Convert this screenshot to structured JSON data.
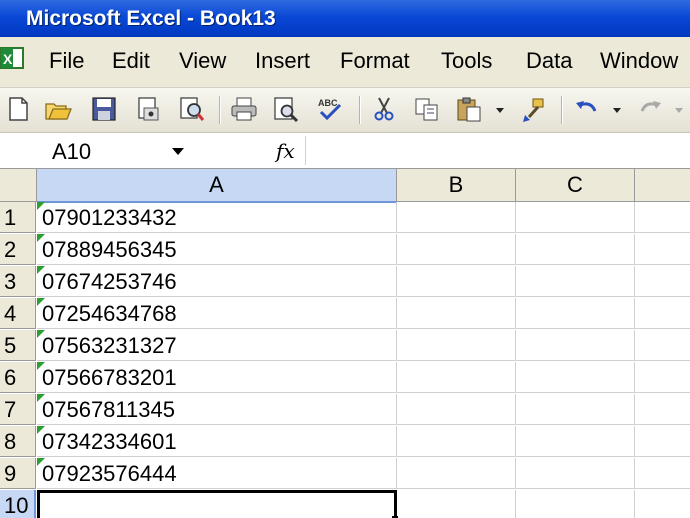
{
  "window": {
    "title": "Microsoft Excel - Book13"
  },
  "menu": {
    "items": [
      "File",
      "Edit",
      "View",
      "Insert",
      "Format",
      "Tools",
      "Data",
      "Window"
    ]
  },
  "toolbar": {
    "buttons": [
      "new-icon",
      "open-icon",
      "save-icon",
      "permission-icon",
      "research-icon",
      "print-icon",
      "print-preview-icon",
      "spelling-icon",
      "cut-icon",
      "copy-icon",
      "paste-icon",
      "paste-dropdown",
      "format-painter-icon",
      "undo-icon",
      "undo-dropdown",
      "redo-icon"
    ]
  },
  "formula_bar": {
    "name_box": "A10",
    "fx": "fx",
    "value": ""
  },
  "sheet": {
    "columns": [
      "A",
      "B",
      "C"
    ],
    "rows": [
      {
        "num": "1",
        "a": "07901233432"
      },
      {
        "num": "2",
        "a": "07889456345"
      },
      {
        "num": "3",
        "a": "07674253746"
      },
      {
        "num": "4",
        "a": "07254634768"
      },
      {
        "num": "5",
        "a": "07563231327"
      },
      {
        "num": "6",
        "a": "07566783201"
      },
      {
        "num": "7",
        "a": "07567811345"
      },
      {
        "num": "8",
        "a": "07342334601"
      },
      {
        "num": "9",
        "a": "07923576444"
      },
      {
        "num": "10",
        "a": ""
      }
    ],
    "active_cell": "A10",
    "colors": {
      "selection": "#c6d8f3",
      "error_indicator": "#2e9e2e",
      "title_bar": "#0a48d6"
    }
  }
}
